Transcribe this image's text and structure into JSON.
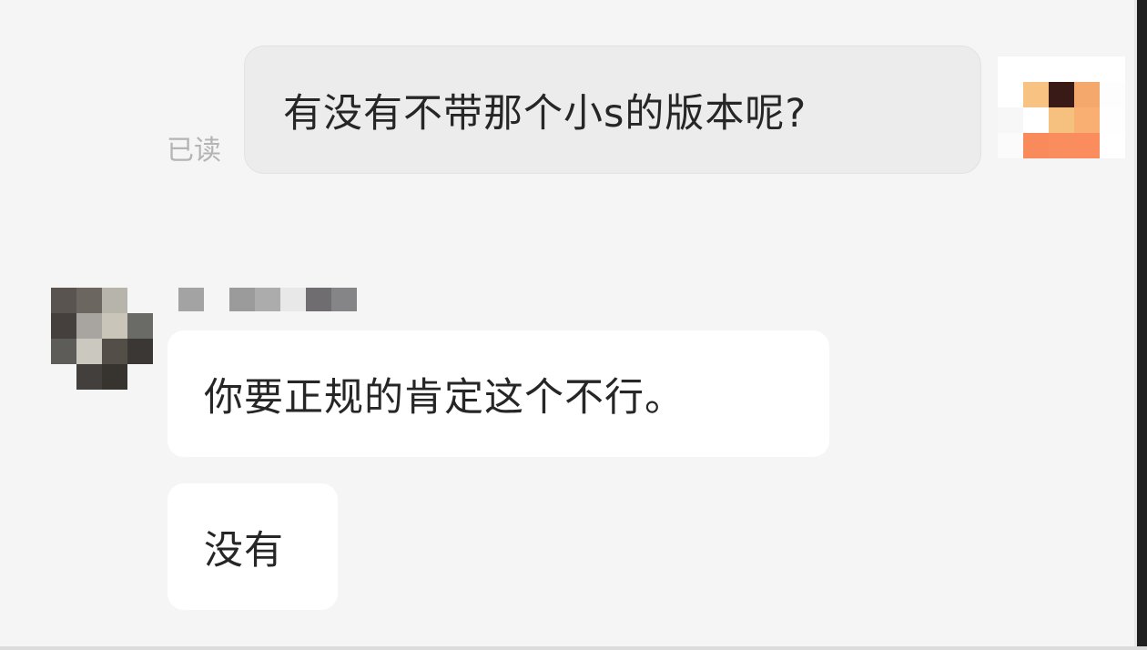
{
  "conversation": {
    "outgoing": {
      "text": "有没有不带那个小s的版本呢?",
      "read_status": "已读",
      "avatar": {
        "icon": "user-avatar-icon",
        "pixels": [
          "#ffffff",
          "#ffffff",
          "#ffffff",
          "#ffffff",
          "#ffffff",
          "#ffffff",
          "#f8c283",
          "#3a1a16",
          "#f4a86c",
          "#fdfdfd",
          "#f7f7f7",
          "#ffffff",
          "#f6c07e",
          "#f8af71",
          "#fefefe",
          "#fbfbfb",
          "#f88a5c",
          "#f98d5e",
          "#fb8c5d",
          "#ffffff"
        ]
      }
    },
    "incoming": {
      "avatar": {
        "icon": "contact-avatar-icon",
        "pixels": [
          "#595450",
          "#6c6660",
          "#b6b4ab",
          "#f5f5f5",
          "#45403e",
          "#a8a49f",
          "#c9c5b8",
          "#6a6a66",
          "#5d5c58",
          "#cbc8c0",
          "#544e49",
          "#3b3734",
          "#f5f5f5",
          "#433f3c",
          "#37342f",
          "#f5f5f5"
        ]
      },
      "sender_name_blocks": [
        "#a3a3a3",
        "#f5f5f5",
        "#9b9b9b",
        "#acacac",
        "#e8e8e8",
        "#6f6d70",
        "#858486"
      ],
      "messages": [
        {
          "text": "你要正规的肯定这个不行。"
        },
        {
          "text": "没有"
        }
      ]
    }
  }
}
